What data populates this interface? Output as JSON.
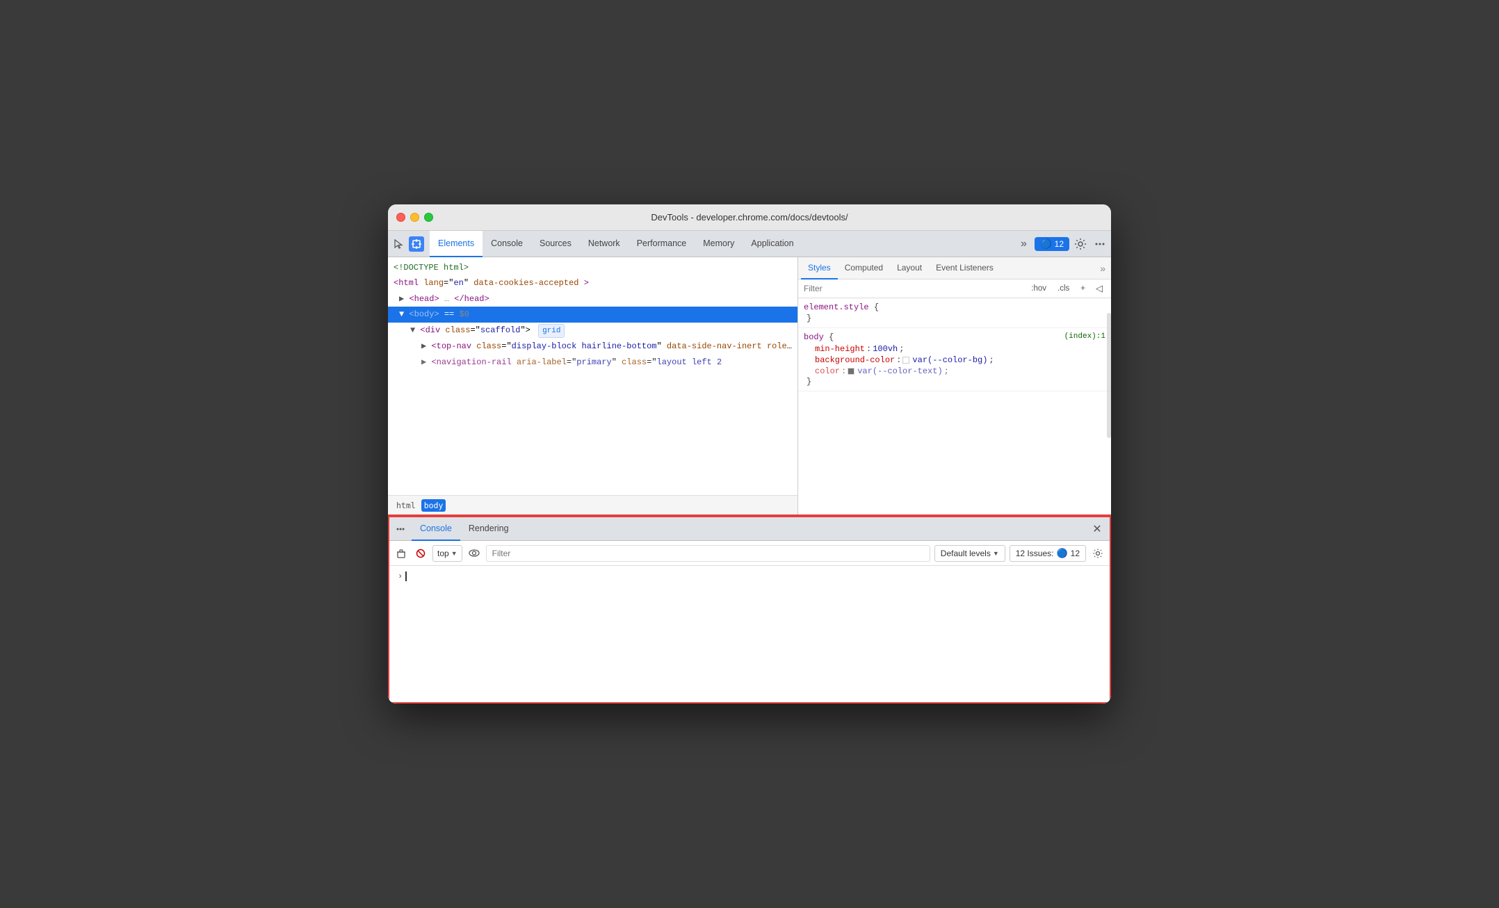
{
  "window": {
    "title": "DevTools - developer.chrome.com/docs/devtools/"
  },
  "traffic_lights": {
    "red": "red",
    "yellow": "yellow",
    "green": "green"
  },
  "main_tabs": {
    "tabs": [
      {
        "id": "elements",
        "label": "Elements",
        "active": true
      },
      {
        "id": "console",
        "label": "Console",
        "active": false
      },
      {
        "id": "sources",
        "label": "Sources",
        "active": false
      },
      {
        "id": "network",
        "label": "Network",
        "active": false
      },
      {
        "id": "performance",
        "label": "Performance",
        "active": false
      },
      {
        "id": "memory",
        "label": "Memory",
        "active": false
      },
      {
        "id": "application",
        "label": "Application",
        "active": false
      }
    ],
    "more_label": "»",
    "issues_label": "12",
    "issues_icon": "🔵"
  },
  "dom_tree": {
    "lines": [
      {
        "text": "<!DOCTYPE html>",
        "type": "comment",
        "indent": 0
      },
      {
        "text": "<html lang=\"en\" data-cookies-accepted>",
        "type": "tag",
        "indent": 0
      },
      {
        "text": "▶<head>…</head>",
        "type": "tag",
        "indent": 1
      },
      {
        "text": "▼<body> == $0",
        "type": "tag",
        "indent": 1,
        "selected": true
      },
      {
        "text": "▼<div class=\"scaffold\">",
        "type": "tag",
        "indent": 2,
        "badge": "grid"
      },
      {
        "text": "▶<top-nav class=\"display-block hairline-bottom\" data-side-nav-inert role=\"banner\">…</top-nav>",
        "type": "tag",
        "indent": 3
      },
      {
        "text": "▶ navigation-rail aria-label=\"primary\" class=\"layout left 2",
        "type": "tag",
        "indent": 3,
        "truncated": true
      }
    ]
  },
  "breadcrumb": {
    "items": [
      {
        "label": "html",
        "active": false
      },
      {
        "label": "body",
        "active": true
      }
    ]
  },
  "styles_panel": {
    "tabs": [
      {
        "id": "styles",
        "label": "Styles",
        "active": true
      },
      {
        "id": "computed",
        "label": "Computed",
        "active": false
      },
      {
        "id": "layout",
        "label": "Layout",
        "active": false
      },
      {
        "id": "event-listeners",
        "label": "Event Listeners",
        "active": false
      }
    ],
    "more_label": "»",
    "filter_placeholder": "Filter",
    "filter_buttons": [
      ":hov",
      ".cls",
      "+",
      "◁"
    ],
    "rules": [
      {
        "selector": "element.style {",
        "closing": "}",
        "props": []
      },
      {
        "selector": "body {",
        "source": "(index):1",
        "closing": "}",
        "props": [
          {
            "name": "min-height",
            "value": "100vh"
          },
          {
            "name": "background-color",
            "value": "var(--color-bg)",
            "has_swatch": true,
            "swatch_color": "white"
          },
          {
            "name": "color",
            "value": "var(--color-text)",
            "has_swatch": true,
            "swatch_color": "dark",
            "truncated": true
          }
        ]
      }
    ]
  },
  "console_section": {
    "tabs": [
      {
        "id": "console",
        "label": "Console",
        "active": true
      },
      {
        "id": "rendering",
        "label": "Rendering",
        "active": false
      }
    ],
    "toolbar": {
      "context": "top",
      "filter_placeholder": "Filter",
      "levels_label": "Default levels",
      "issues_count": "12 Issues:",
      "issues_icon": "🔵",
      "issues_number": "12"
    },
    "prompt": {
      "arrow": "›",
      "cursor": true
    }
  }
}
